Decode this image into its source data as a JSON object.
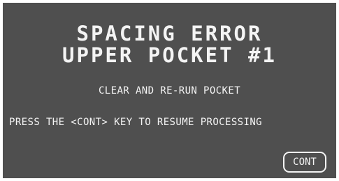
{
  "dialog": {
    "title_line_1": "SPACING ERROR",
    "title_line_2": "UPPER POCKET #1",
    "instruction": "CLEAR AND RE-RUN POCKET",
    "prompt": "PRESS THE <CONT> KEY TO RESUME PROCESSING",
    "cont_label": "CONT"
  },
  "colors": {
    "screen_background": "#4f4f4f",
    "text": "#f4f4f4",
    "page_background": "#ffffff"
  }
}
